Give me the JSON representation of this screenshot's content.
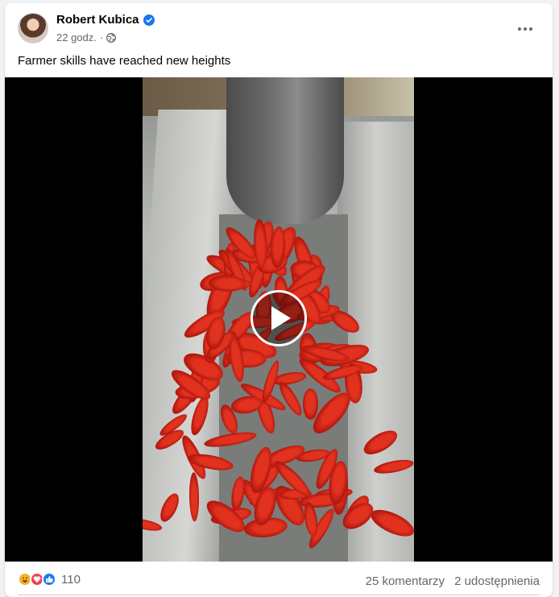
{
  "post": {
    "author": "Robert Kubica",
    "time": "22 godz.",
    "separator": "·",
    "text": "Farmer skills have reached new heights"
  },
  "stats": {
    "reaction_count": "110",
    "reactions": [
      "haha-icon",
      "love-icon",
      "like-icon"
    ],
    "comments": "25 komentarzy",
    "shares": "2 udostępnienia"
  },
  "colors": {
    "verified": "#1877f2",
    "secondary_text": "#65676b",
    "like": "#1877f2",
    "love": "#f33e58",
    "haha": "#f7b125"
  }
}
